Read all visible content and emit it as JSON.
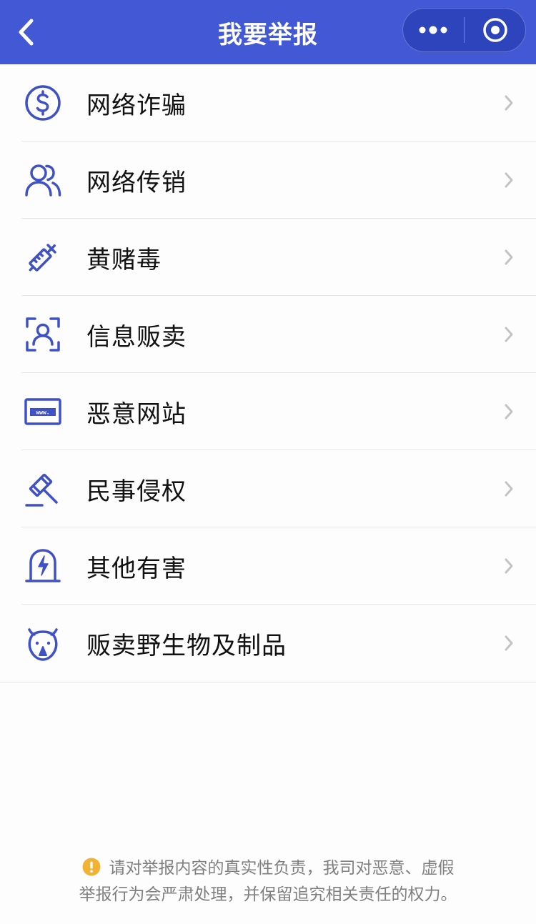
{
  "header": {
    "title": "我要举报"
  },
  "items": [
    {
      "label": "网络诈骗",
      "icon": "dollar-circle-icon"
    },
    {
      "label": "网络传销",
      "icon": "users-icon"
    },
    {
      "label": "黄赌毒",
      "icon": "syringe-icon"
    },
    {
      "label": "信息贩卖",
      "icon": "face-scan-icon"
    },
    {
      "label": "恶意网站",
      "icon": "website-card-icon"
    },
    {
      "label": "民事侵权",
      "icon": "gavel-icon"
    },
    {
      "label": "其他有害",
      "icon": "alarm-lamp-icon"
    },
    {
      "label": "贩卖野生物及制品",
      "icon": "rhino-icon"
    }
  ],
  "notice": {
    "line1": "请对举报内容的真实性负责，我司对恶意、虚假",
    "line2": "举报行为会严肃处理，并保留追究相关责任的权力。"
  },
  "colors": {
    "header_bg": "#4258d4",
    "icon_blue": "#3f51c6",
    "warning_yellow": "#f2b233",
    "chevron": "#c3c3c3"
  }
}
